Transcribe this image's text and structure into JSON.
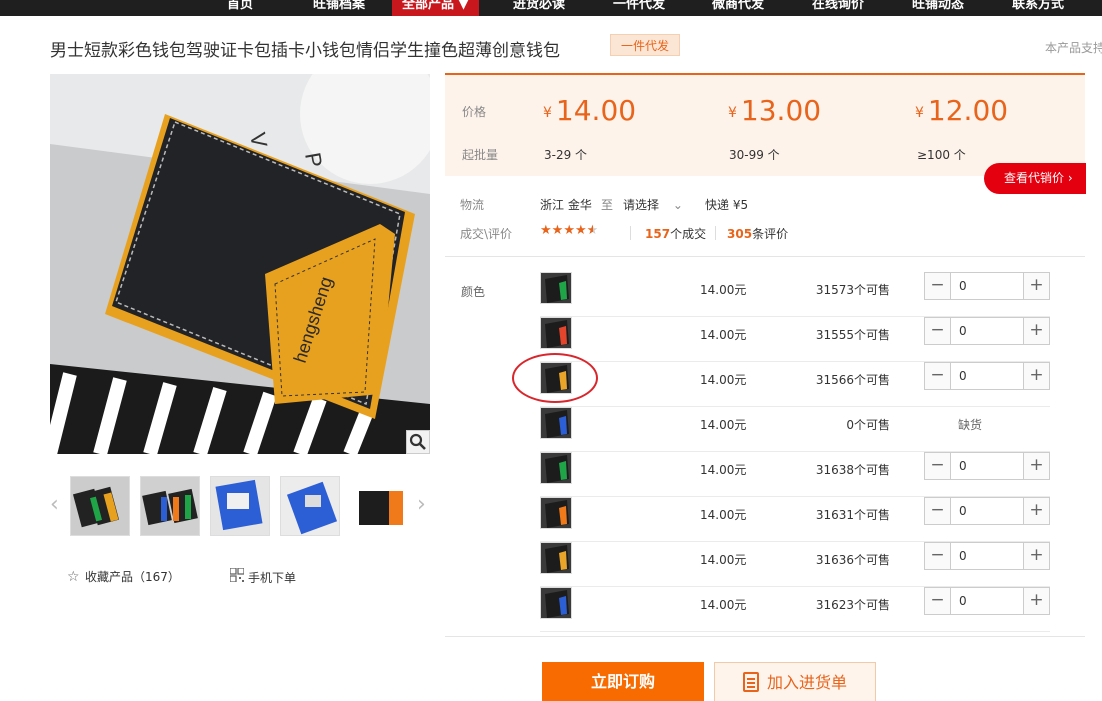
{
  "nav": {
    "items": [
      "首页",
      "旺铺档案",
      "全部产品 ▼",
      "进货必读",
      "一件代发",
      "微商代发",
      "在线询价",
      "旺铺动态",
      "联系方式"
    ]
  },
  "product": {
    "title": "男士短款彩色钱包驾驶证卡包插卡小钱包情侣学生撞色超薄创意钱包",
    "tag": "一件代发",
    "support_text": "本产品支持"
  },
  "gallery": {
    "brand_text": "hengsheng",
    "fav_label": "收藏产品（167）",
    "mobile_label": "手机下单"
  },
  "pricing": {
    "price_label": "价格",
    "moq_label": "起批量",
    "tiers": [
      {
        "currency": "¥",
        "price": "14.00",
        "range": "3-29 个"
      },
      {
        "currency": "¥",
        "price": "13.00",
        "range": "30-99 个"
      },
      {
        "currency": "¥",
        "price": "12.00",
        "range": "≥100 个"
      }
    ],
    "agent_button": "查看代销价 ›"
  },
  "logistics": {
    "label": "物流",
    "from": "浙江 金华",
    "to_word": "至",
    "select_placeholder": "请选择",
    "shipping": "快递 ¥5",
    "deal_label": "成交\\评价",
    "deals_count": "157",
    "deals_suffix": "个成交",
    "reviews_count": "305",
    "reviews_suffix": "条评价",
    "rating": 4.5
  },
  "sku": {
    "label": "颜色",
    "rows": [
      {
        "accent": "#1fa548",
        "price": "14.00元",
        "stock": "31573个可售",
        "qty": "0",
        "soldout": false
      },
      {
        "accent": "#e2452b",
        "price": "14.00元",
        "stock": "31555个可售",
        "qty": "0",
        "soldout": false
      },
      {
        "accent": "#e8a52a",
        "price": "14.00元",
        "stock": "31566个可售",
        "qty": "0",
        "soldout": false
      },
      {
        "accent": "#2c5fd6",
        "price": "14.00元",
        "stock": "0个可售",
        "qty": "",
        "soldout": true,
        "soldout_text": "缺货"
      },
      {
        "accent": "#1fa548",
        "price": "14.00元",
        "stock": "31638个可售",
        "qty": "0",
        "soldout": false
      },
      {
        "accent": "#f07a1a",
        "price": "14.00元",
        "stock": "31631个可售",
        "qty": "0",
        "soldout": false
      },
      {
        "accent": "#e8a52a",
        "price": "14.00元",
        "stock": "31636个可售",
        "qty": "0",
        "soldout": false
      },
      {
        "accent": "#2c5fd6",
        "price": "14.00元",
        "stock": "31623个可售",
        "qty": "0",
        "soldout": false
      }
    ]
  },
  "actions": {
    "buy_now": "立即订购",
    "add_cart": "加入进货单"
  },
  "colors": {
    "accent": "#e8641b",
    "nav_active": "#c9171e",
    "buy_button": "#f76b00",
    "agent_button": "#e4000f"
  }
}
